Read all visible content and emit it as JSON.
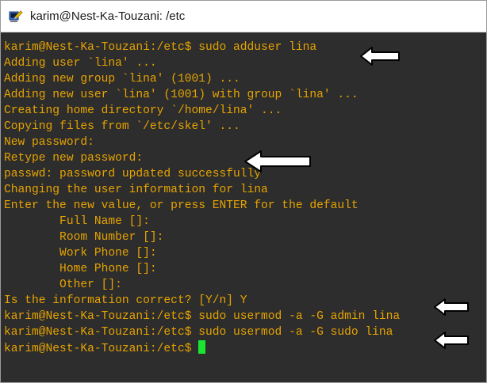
{
  "window": {
    "title": "karim@Nest-Ka-Touzani: /etc",
    "icon": "terminal-app-icon"
  },
  "colors": {
    "terminal_bg": "#2d2d2d",
    "terminal_text": "#e6a300",
    "cursor": "#19e62e",
    "arrow_fill": "#ffffff",
    "arrow_stroke": "#000000"
  },
  "terminal": {
    "lines": [
      "karim@Nest-Ka-Touzani:/etc$ sudo adduser lina",
      "Adding user `lina' ...",
      "Adding new group `lina' (1001) ...",
      "Adding new user `lina' (1001) with group `lina' ...",
      "Creating home directory `/home/lina' ...",
      "Copying files from `/etc/skel' ...",
      "New password:",
      "Retype new password:",
      "passwd: password updated successfully",
      "Changing the user information for lina",
      "Enter the new value, or press ENTER for the default",
      "        Full Name []:",
      "        Room Number []:",
      "        Work Phone []:",
      "        Home Phone []:",
      "        Other []:",
      "Is the information correct? [Y/n] Y",
      "karim@Nest-Ka-Touzani:/etc$ sudo usermod -a -G admin lina",
      "karim@Nest-Ka-Touzani:/etc$ sudo usermod -a -G sudo lina"
    ],
    "prompt": "karim@Nest-Ka-Touzani:/etc$ "
  },
  "annotations": {
    "arrow_icon": "left-arrow-icon"
  }
}
